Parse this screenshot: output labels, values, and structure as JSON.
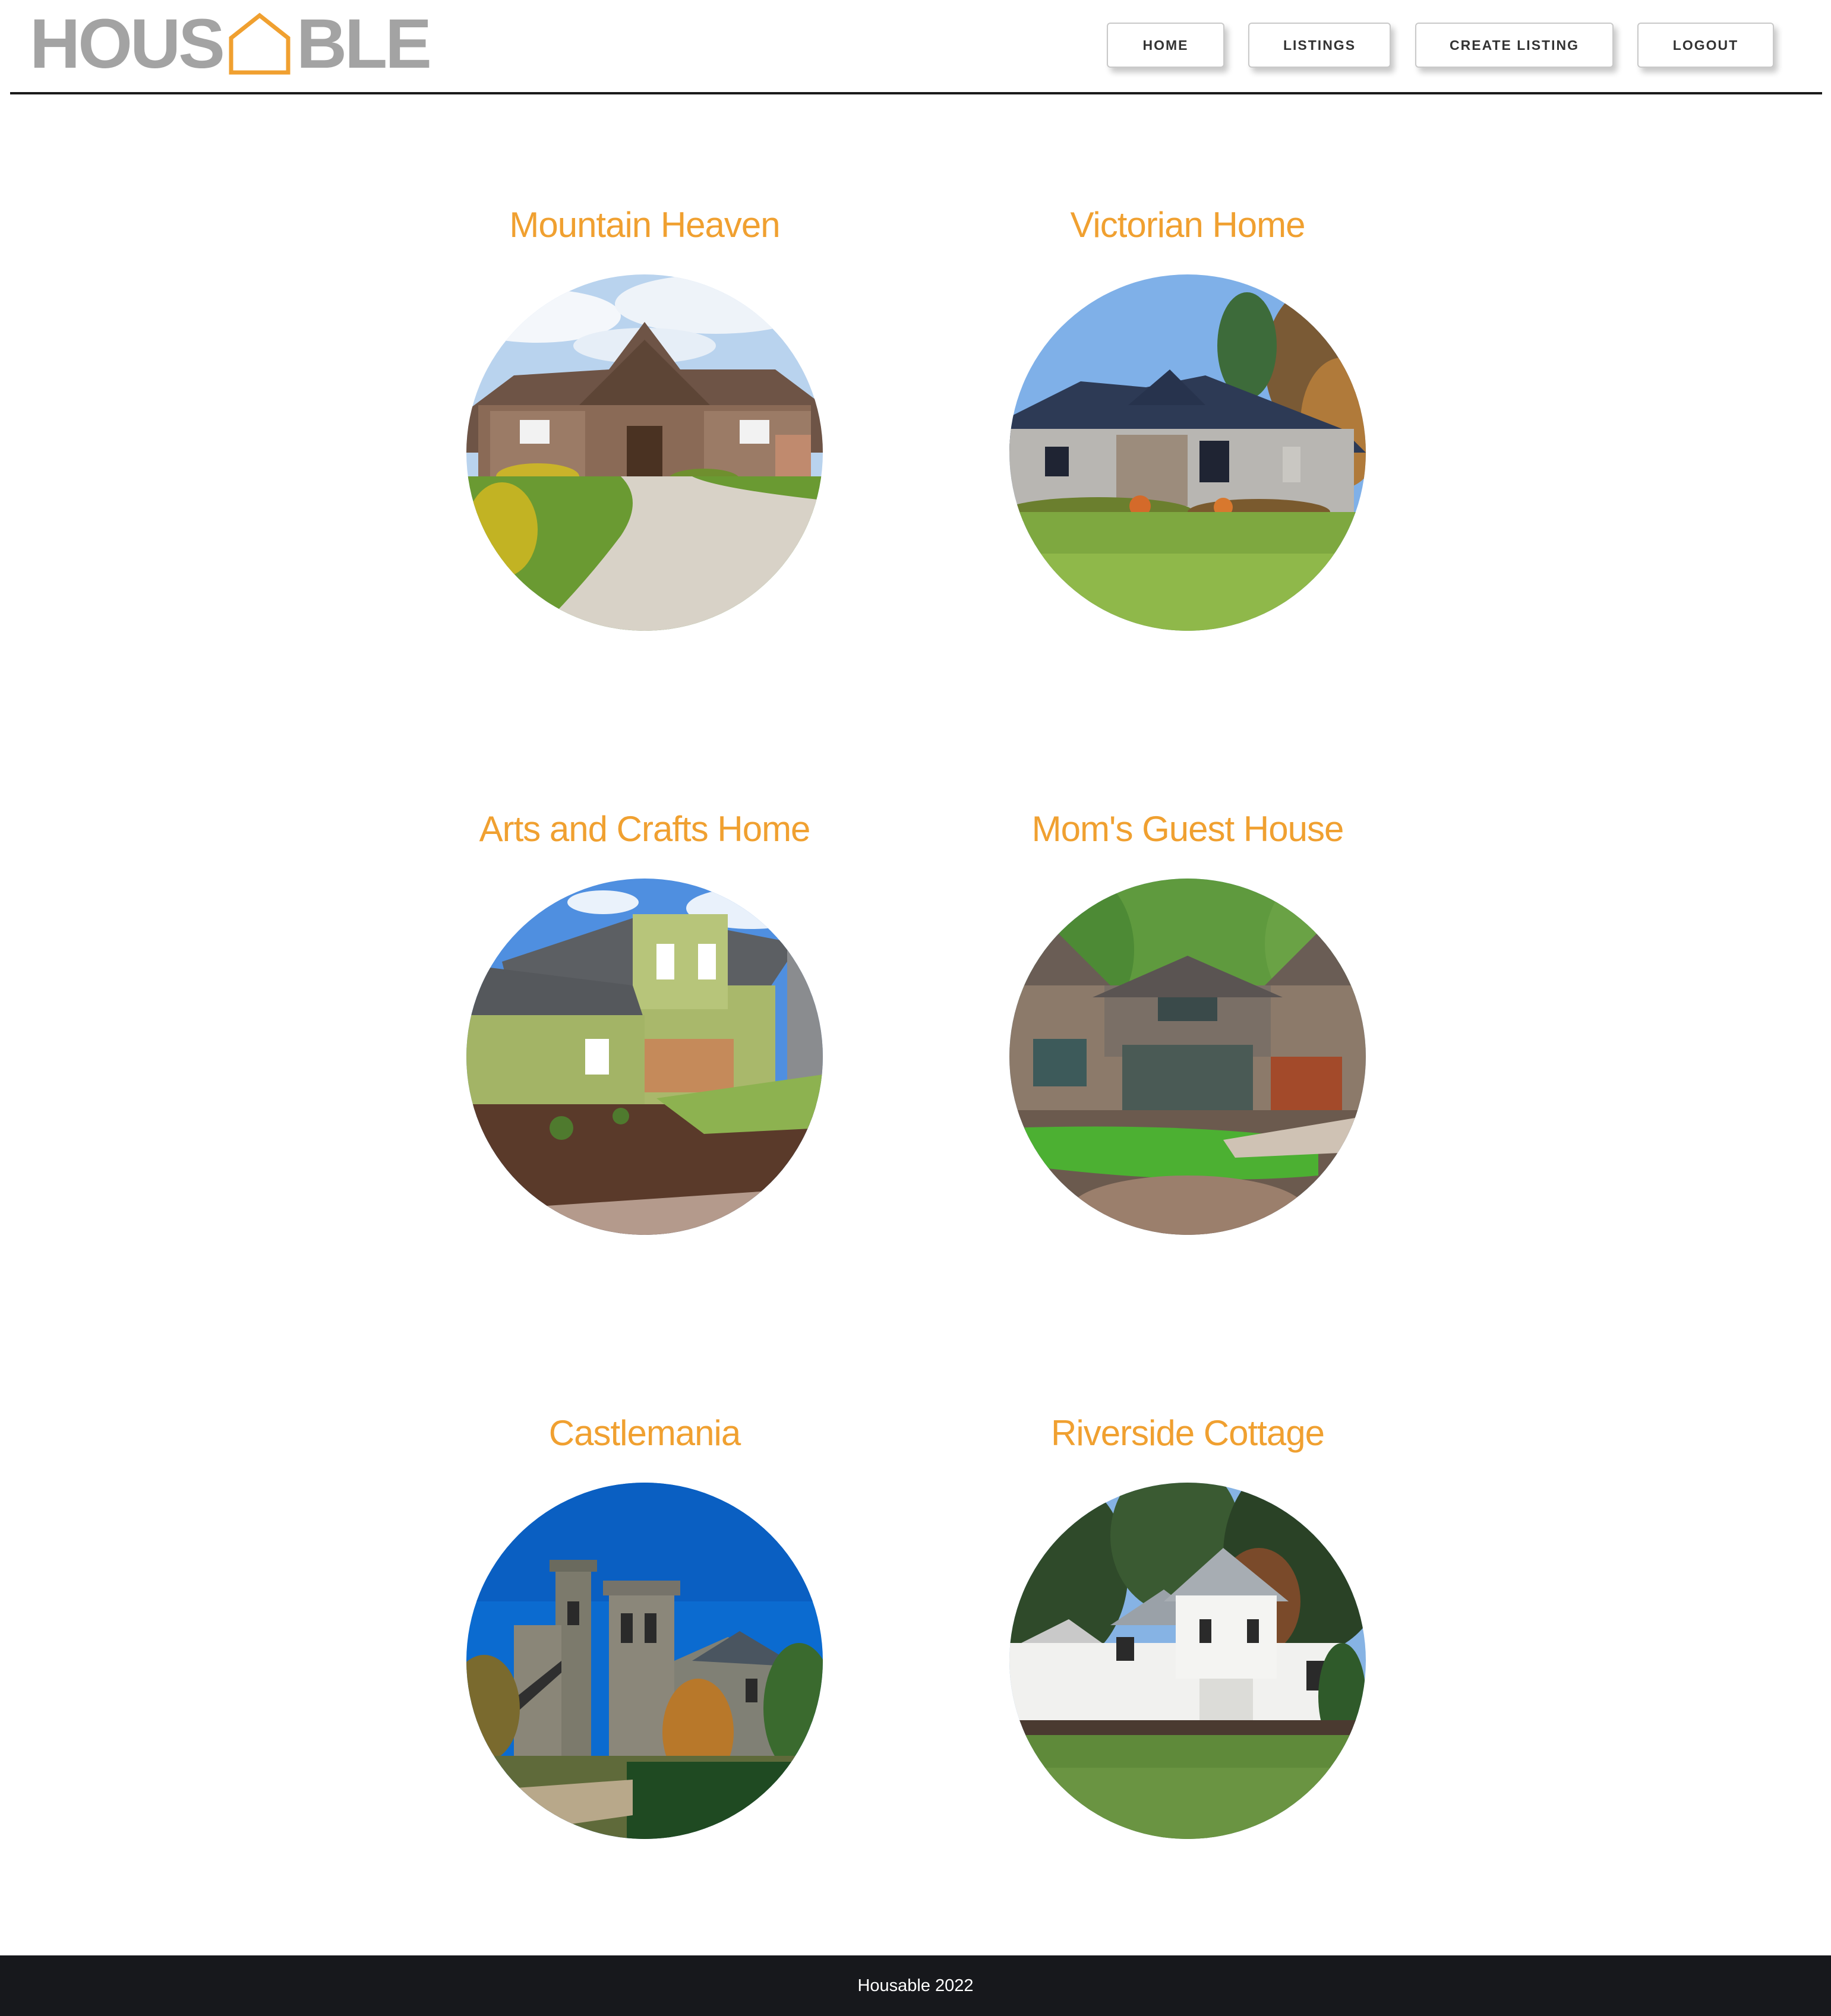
{
  "brand": {
    "logo_left": "HOUS",
    "logo_right": "BLE",
    "logo_text_color": "#a3a3a3",
    "logo_house_color": "#f0a030"
  },
  "nav": {
    "home": "HOME",
    "listings": "LISTINGS",
    "create_listing": "CREATE LISTING",
    "logout": "LOGOUT"
  },
  "listings": [
    {
      "title": "Mountain Heaven",
      "photo": "stone-craftsman-house-photo"
    },
    {
      "title": "Victorian Home",
      "photo": "gray-ranch-house-photo"
    },
    {
      "title": "Arts and Crafts Home",
      "photo": "green-two-story-house-photo"
    },
    {
      "title": "Mom's Guest House",
      "photo": "stone-cottage-house-photo"
    },
    {
      "title": "Castlemania",
      "photo": "stone-castle-photo"
    },
    {
      "title": "Riverside Cottage",
      "photo": "white-farmhouse-photo"
    }
  ],
  "accent_color": "#f0a030",
  "footer": {
    "text": "Housable 2022"
  }
}
